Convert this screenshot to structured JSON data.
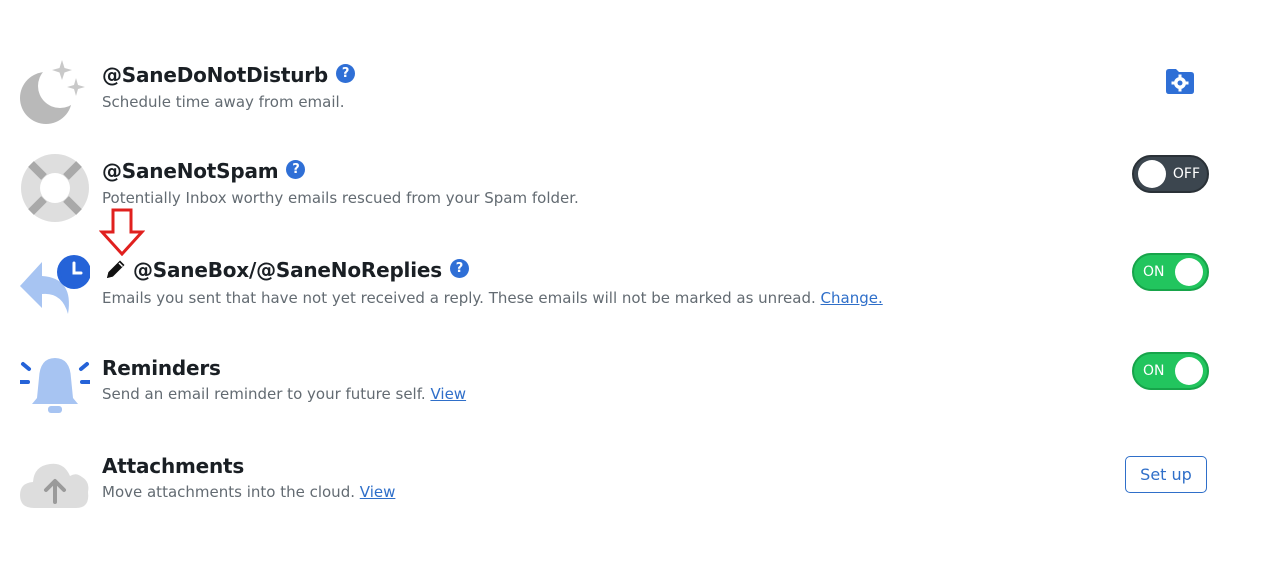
{
  "features": [
    {
      "title": "@SaneDoNotDisturb",
      "help": "?",
      "description": "Schedule time away from email.",
      "icon": "moon-stars-icon",
      "control": "settings-folder-icon"
    },
    {
      "title": "@SaneNotSpam",
      "help": "?",
      "description": "Potentially Inbox worthy emails rescued from your Spam folder.",
      "icon": "lifebuoy-icon",
      "toggle": "OFF"
    },
    {
      "title": "@SaneBox/@SaneNoReplies",
      "help": "?",
      "description": "Emails you sent that have not yet received a reply. These emails will not be marked as unread.",
      "link": "Change.",
      "icon": "reply-clock-icon",
      "edit_icon": "pencil-icon",
      "annotation_icon": "red-down-arrow-icon",
      "toggle": "ON"
    },
    {
      "title": "Reminders",
      "description": "Send an email reminder to your future self.",
      "link": "View",
      "icon": "bell-icon",
      "toggle": "ON"
    },
    {
      "title": "Attachments",
      "description": "Move attachments into the cloud.",
      "link": "View",
      "icon": "cloud-upload-icon",
      "button": "Set up"
    }
  ],
  "colors": {
    "toggle_on": "#22c55e",
    "toggle_off": "#3c464f",
    "accent_blue": "#2f6fd6",
    "link": "#2f6fc9",
    "annotation_red": "#e0201e"
  }
}
